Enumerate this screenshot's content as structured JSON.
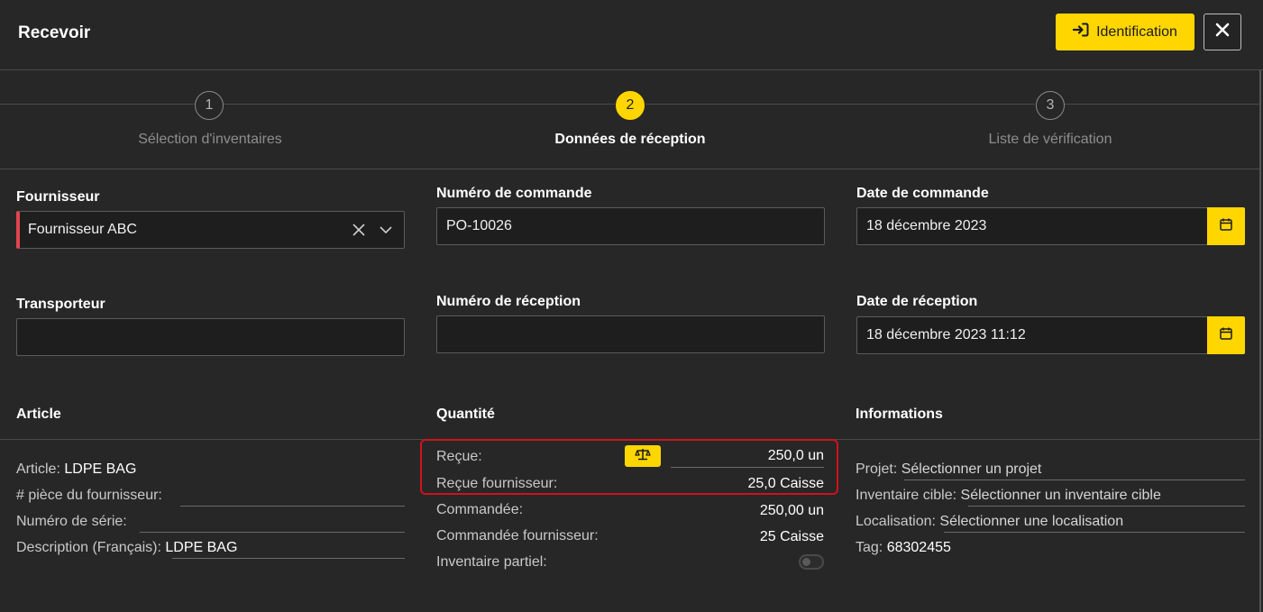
{
  "header": {
    "title": "Recevoir",
    "identification_label": "Identification"
  },
  "steps": [
    {
      "number": "1",
      "label": "Sélection d'inventaires"
    },
    {
      "number": "2",
      "label": "Données de réception"
    },
    {
      "number": "3",
      "label": "Liste de vérification"
    }
  ],
  "form": {
    "supplier": {
      "label": "Fournisseur",
      "value": "Fournisseur ABC"
    },
    "order_number": {
      "label": "Numéro de commande",
      "value": "PO-10026"
    },
    "order_date": {
      "label": "Date de commande",
      "value": "18 décembre 2023"
    },
    "carrier": {
      "label": "Transporteur",
      "value": ""
    },
    "receipt_number": {
      "label": "Numéro de réception",
      "value": ""
    },
    "receipt_date": {
      "label": "Date de réception",
      "value": "18 décembre 2023 11:12"
    }
  },
  "article": {
    "title": "Article",
    "article_label": "Article:",
    "article_value": "LDPE BAG",
    "supplier_part_label": "# pièce du fournisseur:",
    "serial_label": "Numéro de série:",
    "description_label": "Description (Français):",
    "description_value": "LDPE BAG"
  },
  "quantity": {
    "title": "Quantité",
    "received_label": "Reçue:",
    "received_value": "250,0 un",
    "received_supplier_label": "Reçue fournisseur:",
    "received_supplier_value": "25,0 Caisse",
    "ordered_label": "Commandée:",
    "ordered_value": "250,00 un",
    "ordered_supplier_label": "Commandée fournisseur:",
    "ordered_supplier_value": "25 Caisse",
    "partial_label": "Inventaire partiel:",
    "partial_enabled": false
  },
  "informations": {
    "title": "Informations",
    "project_label": "Projet:",
    "project_value": "Sélectionner un projet",
    "target_label": "Inventaire cible:",
    "target_value": "Sélectionner un inventaire cible",
    "location_label": "Localisation:",
    "location_value": "Sélectionner une localisation",
    "tag_label": "Tag:",
    "tag_value": "68302455"
  },
  "colors": {
    "accent": "#ffd600",
    "background": "#272727",
    "required": "#e0454b",
    "highlight": "#d0121c"
  }
}
